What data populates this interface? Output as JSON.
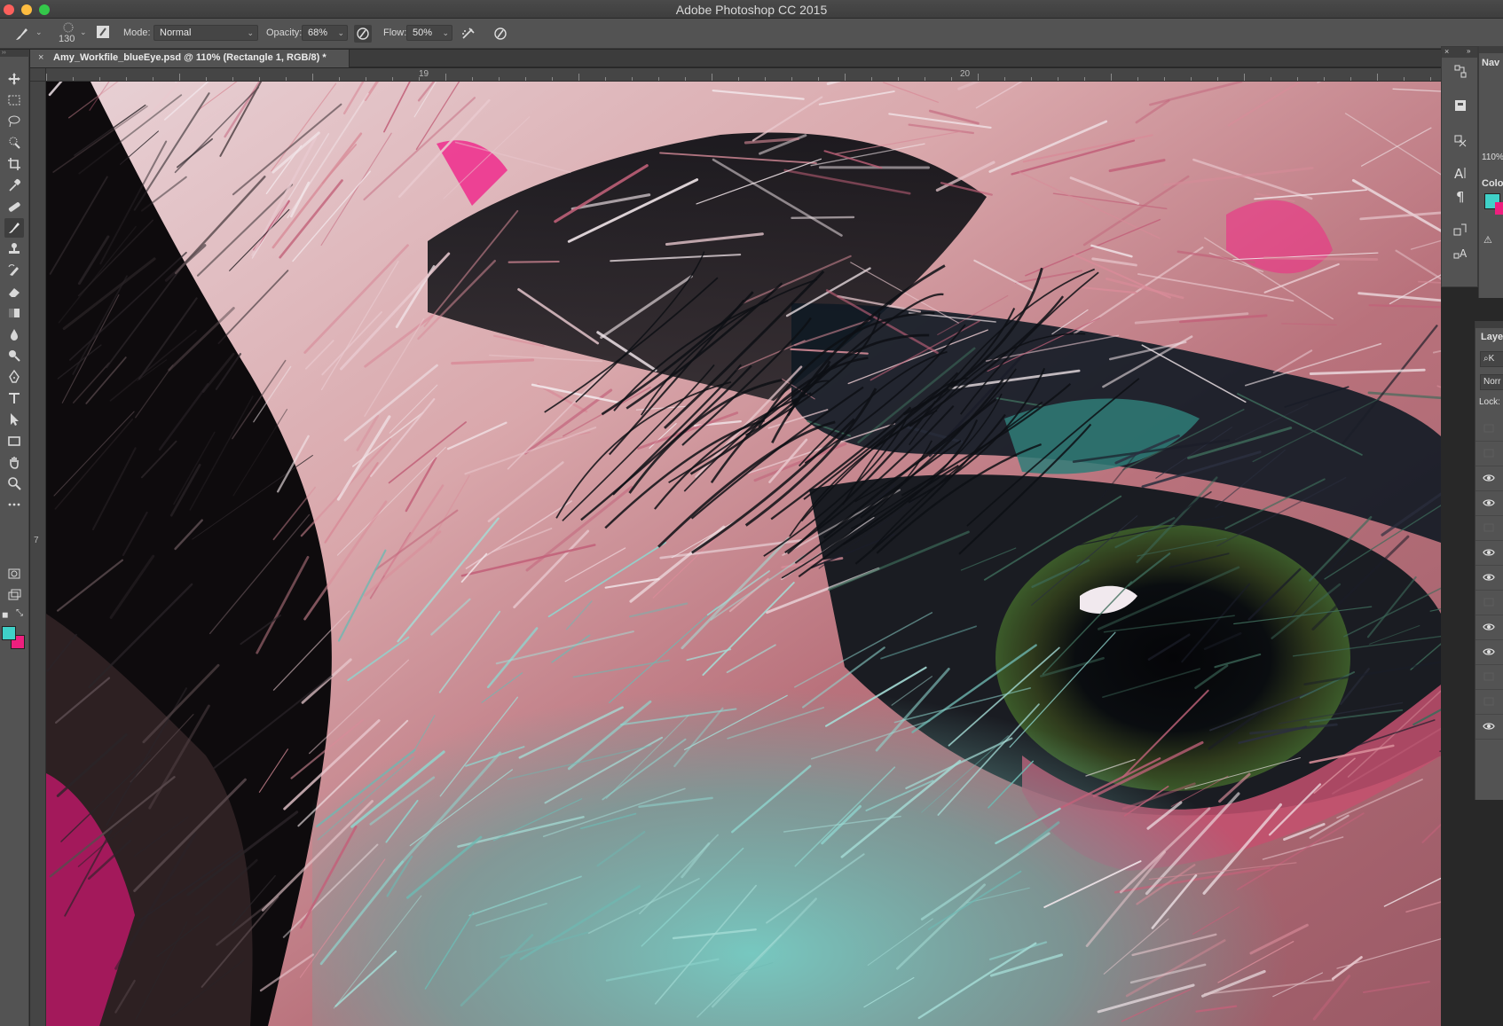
{
  "window": {
    "title": "Adobe Photoshop CC 2015"
  },
  "options_bar": {
    "brush_size": "130",
    "mode_label": "Mode:",
    "mode_value": "Normal",
    "opacity_label": "Opacity:",
    "opacity_value": "68%",
    "flow_label": "Flow:",
    "flow_value": "50%"
  },
  "document_tab": {
    "title": "Amy_Workfile_blueEye.psd @ 110% (Rectangle 1, RGB/8) *",
    "close": "×"
  },
  "rulers": {
    "top_labels": [
      "19",
      "20"
    ],
    "left_labels": [
      "7"
    ]
  },
  "tools": [
    {
      "name": "move-tool",
      "icon": "move-icon"
    },
    {
      "name": "marquee-tool",
      "icon": "rect-marquee-icon"
    },
    {
      "name": "lasso-tool",
      "icon": "lasso-icon"
    },
    {
      "name": "quick-select-tool",
      "icon": "quick-select-icon"
    },
    {
      "name": "crop-tool",
      "icon": "crop-icon"
    },
    {
      "name": "eyedropper-tool",
      "icon": "eyedropper-icon"
    },
    {
      "name": "healing-tool",
      "icon": "bandage-icon"
    },
    {
      "name": "brush-tool",
      "icon": "brush-icon"
    },
    {
      "name": "stamp-tool",
      "icon": "stamp-icon"
    },
    {
      "name": "history-brush-tool",
      "icon": "history-brush-icon"
    },
    {
      "name": "eraser-tool",
      "icon": "eraser-icon"
    },
    {
      "name": "gradient-tool",
      "icon": "gradient-icon"
    },
    {
      "name": "blur-tool",
      "icon": "drop-icon"
    },
    {
      "name": "dodge-tool",
      "icon": "dodge-icon"
    },
    {
      "name": "pen-tool",
      "icon": "pen-icon"
    },
    {
      "name": "type-tool",
      "icon": "type-icon"
    },
    {
      "name": "path-select-tool",
      "icon": "arrow-icon"
    },
    {
      "name": "shape-tool",
      "icon": "rectangle-icon"
    },
    {
      "name": "hand-tool",
      "icon": "hand-icon"
    },
    {
      "name": "zoom-tool",
      "icon": "magnifier-icon"
    },
    {
      "name": "more-tools",
      "icon": "ellipsis-icon"
    }
  ],
  "colors": {
    "foreground": "#3fd1c8",
    "background": "#ee1f7e"
  },
  "right_panels": {
    "navigator_tab": "Nav",
    "zoom_value": "110%",
    "color_tab": "Colo",
    "layers_tab": "Laye",
    "search_placeholder": "K",
    "blend_mode": "Norr",
    "lock_label": "Lock:"
  },
  "layers_visibility": [
    false,
    false,
    true,
    true,
    false,
    true,
    true,
    false,
    true,
    true,
    false,
    false,
    true
  ]
}
